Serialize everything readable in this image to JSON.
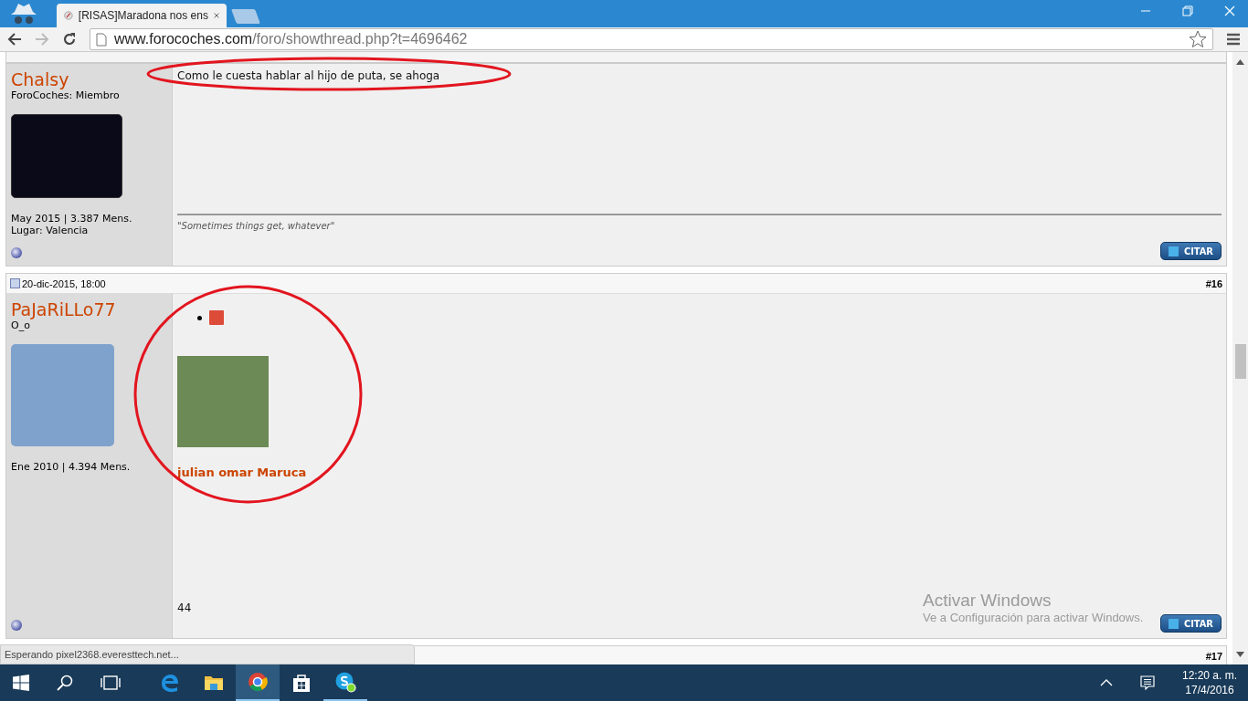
{
  "browser": {
    "tab_title": "[RISAS]Maradona nos ens",
    "url_domain": "www.forocoches.com",
    "url_path": "/foro/showthread.php?t=4696462"
  },
  "posts": [
    {
      "user": "Chalsy",
      "user_title": "ForoCoches: Miembro",
      "stats": "May 2015 | 3.387 Mens.",
      "location": "Lugar: Valencia",
      "message": "Como le cuesta hablar al hijo de puta, se ahoga",
      "signature": "\"Sometimes things get, whatever\"",
      "quote_button": "CITAR"
    },
    {
      "date": "20-dic-2015, 18:00",
      "number": "#16",
      "user": "PaJaRiLLo77",
      "user_title": "O_o",
      "stats": "Ene 2010 | 4.394 Mens.",
      "embed_name": "julian omar Maruca",
      "message": "44",
      "quote_button": "CITAR"
    },
    {
      "number": "#17"
    }
  ],
  "status_bar": "Esperando pixel2368.everesttech.net...",
  "activation_notice": {
    "title": "Activar Windows",
    "text": "Ve a Configuración para activar Windows."
  },
  "taskbar": {
    "time": "12:20 a. m.",
    "date": "17/4/2016"
  }
}
